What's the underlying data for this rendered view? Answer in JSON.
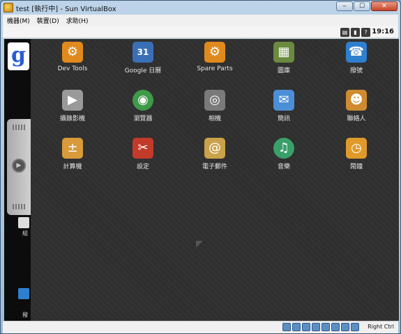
{
  "window": {
    "title": "test [執行中] - Sun VirtualBox"
  },
  "caption": {
    "minimize": "‒",
    "maximize": "☐",
    "close": "✕"
  },
  "menubar": {
    "items": [
      "機器(M)",
      "裝置(D)",
      "求助(H)"
    ]
  },
  "android_status": {
    "clock": "19:16"
  },
  "home": {
    "google_letter": "g",
    "stub_label_1": "組",
    "stub_label_2": "撥"
  },
  "apps": [
    {
      "label": "Dev Tools",
      "icon": "gear-icon",
      "glyph": "⚙",
      "color": "#e08a1e"
    },
    {
      "label": "Google 日曆",
      "icon": "calendar-icon",
      "glyph": "31",
      "color": "#3a6fb8"
    },
    {
      "label": "Spare Parts",
      "icon": "gear-icon",
      "glyph": "⚙",
      "color": "#e08a1e"
    },
    {
      "label": "圖庫",
      "icon": "gallery-icon",
      "glyph": "▦",
      "color": "#6b8a3e"
    },
    {
      "label": "撥號",
      "icon": "phone-icon",
      "glyph": "☎",
      "color": "#2f7fd0"
    },
    {
      "label": "攝錄影機",
      "icon": "camcorder-icon",
      "glyph": "▶",
      "color": "#9a9a9a"
    },
    {
      "label": "瀏覽器",
      "icon": "globe-icon",
      "glyph": "◉",
      "color": "#3f9a4a"
    },
    {
      "label": "相機",
      "icon": "camera-icon",
      "glyph": "◎",
      "color": "#7a7a7a"
    },
    {
      "label": "簡訊",
      "icon": "messaging-icon",
      "glyph": "✉",
      "color": "#4c8fd6"
    },
    {
      "label": "聯絡人",
      "icon": "contacts-icon",
      "glyph": "☻",
      "color": "#d08b2e"
    },
    {
      "label": "計算機",
      "icon": "calculator-icon",
      "glyph": "±",
      "color": "#d89a3a"
    },
    {
      "label": "設定",
      "icon": "settings-icon",
      "glyph": "✂",
      "color": "#c23a2a"
    },
    {
      "label": "電子郵件",
      "icon": "email-icon",
      "glyph": "@",
      "color": "#c9a24a"
    },
    {
      "label": "音樂",
      "icon": "music-icon",
      "glyph": "♫",
      "color": "#3aa06a"
    },
    {
      "label": "鬧鐘",
      "icon": "alarm-clock-icon",
      "glyph": "◷",
      "color": "#e09a2a"
    }
  ],
  "bottombar": {
    "host_key": "Right Ctrl"
  }
}
